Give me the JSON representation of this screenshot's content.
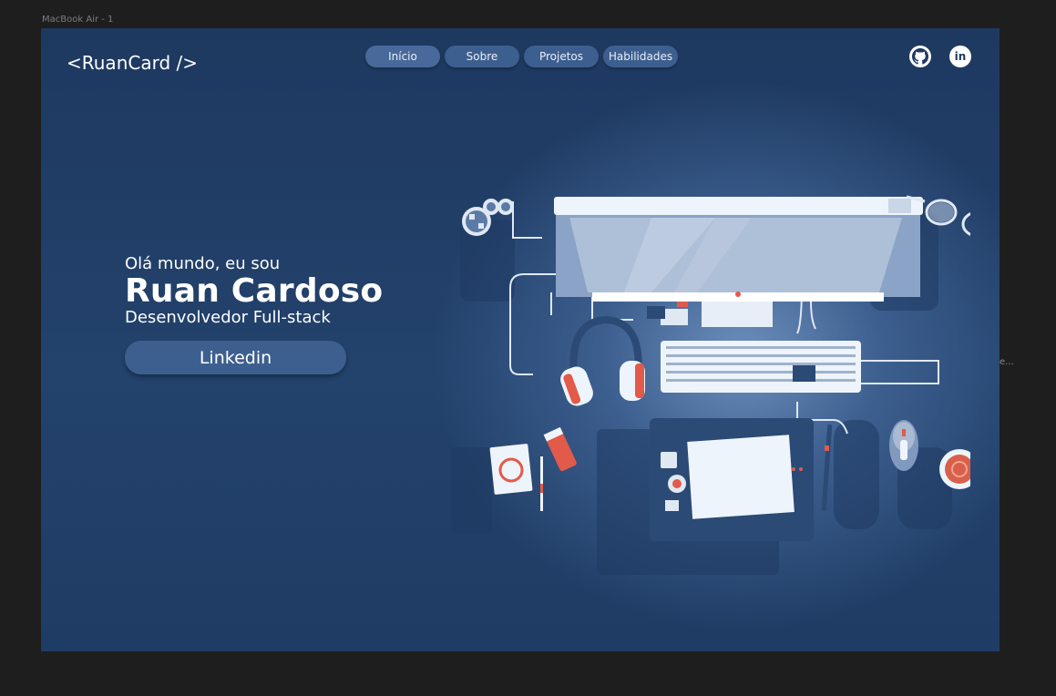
{
  "canvas": {
    "frame_label": "MacBook Air - 1",
    "side_hint": "e..."
  },
  "header": {
    "logo": "<RuanCard />",
    "nav": [
      {
        "label": "Início",
        "active": true
      },
      {
        "label": "Sobre",
        "active": false
      },
      {
        "label": "Projetos",
        "active": false
      },
      {
        "label": "Habilidades",
        "active": false
      }
    ],
    "social": [
      {
        "icon": "github-icon"
      },
      {
        "icon": "linkedin-icon",
        "text": "in"
      }
    ]
  },
  "hero": {
    "greeting": "Olá mundo, eu sou",
    "name": "Ruan Cardoso",
    "role": "Desenvolvedor Full-stack",
    "cta_label": "Linkedin"
  },
  "colors": {
    "background": "#1e3960",
    "button": "#3d5f8f",
    "text": "#ffffff",
    "canvas": "#1e1e1e"
  }
}
